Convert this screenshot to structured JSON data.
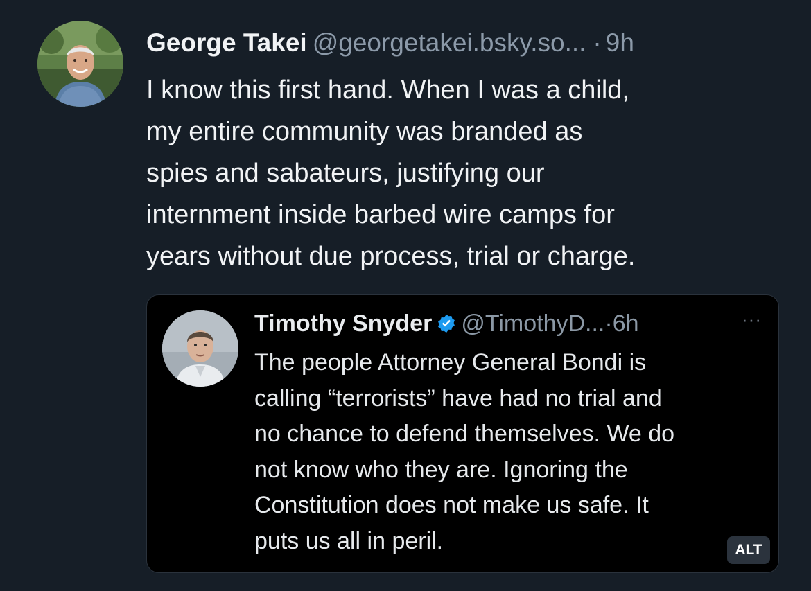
{
  "post": {
    "author": {
      "display_name": "George Takei",
      "handle": "@georgetakei.bsky.so...",
      "avatar_icon": "avatar-icon"
    },
    "separator": "·",
    "time": "9h",
    "text": "I know this first hand. When I was a child,\nmy entire community was branded as\nspies and sabateurs, justifying our\ninternment inside barbed wire camps for\nyears without due process, trial or charge."
  },
  "embed": {
    "author": {
      "display_name": "Timothy Snyder",
      "handle": "@TimothyD...",
      "verified_icon": "verified-badge-icon",
      "verified_color": "#1d9bf0"
    },
    "time": "·6h",
    "more": "···",
    "text": "The people Attorney General Bondi is\ncalling “terrorists” have had no trial and\nno chance to defend themselves. We do\nnot know who they are. Ignoring the\nConstitution does not make us safe. It\nputs us all in peril.",
    "alt_label": "ALT"
  },
  "colors": {
    "background": "#161e27",
    "text_primary": "#f1f3f5",
    "text_secondary": "#8c9aa9",
    "embed_background": "#000000",
    "alt_badge": "#2b333d"
  }
}
